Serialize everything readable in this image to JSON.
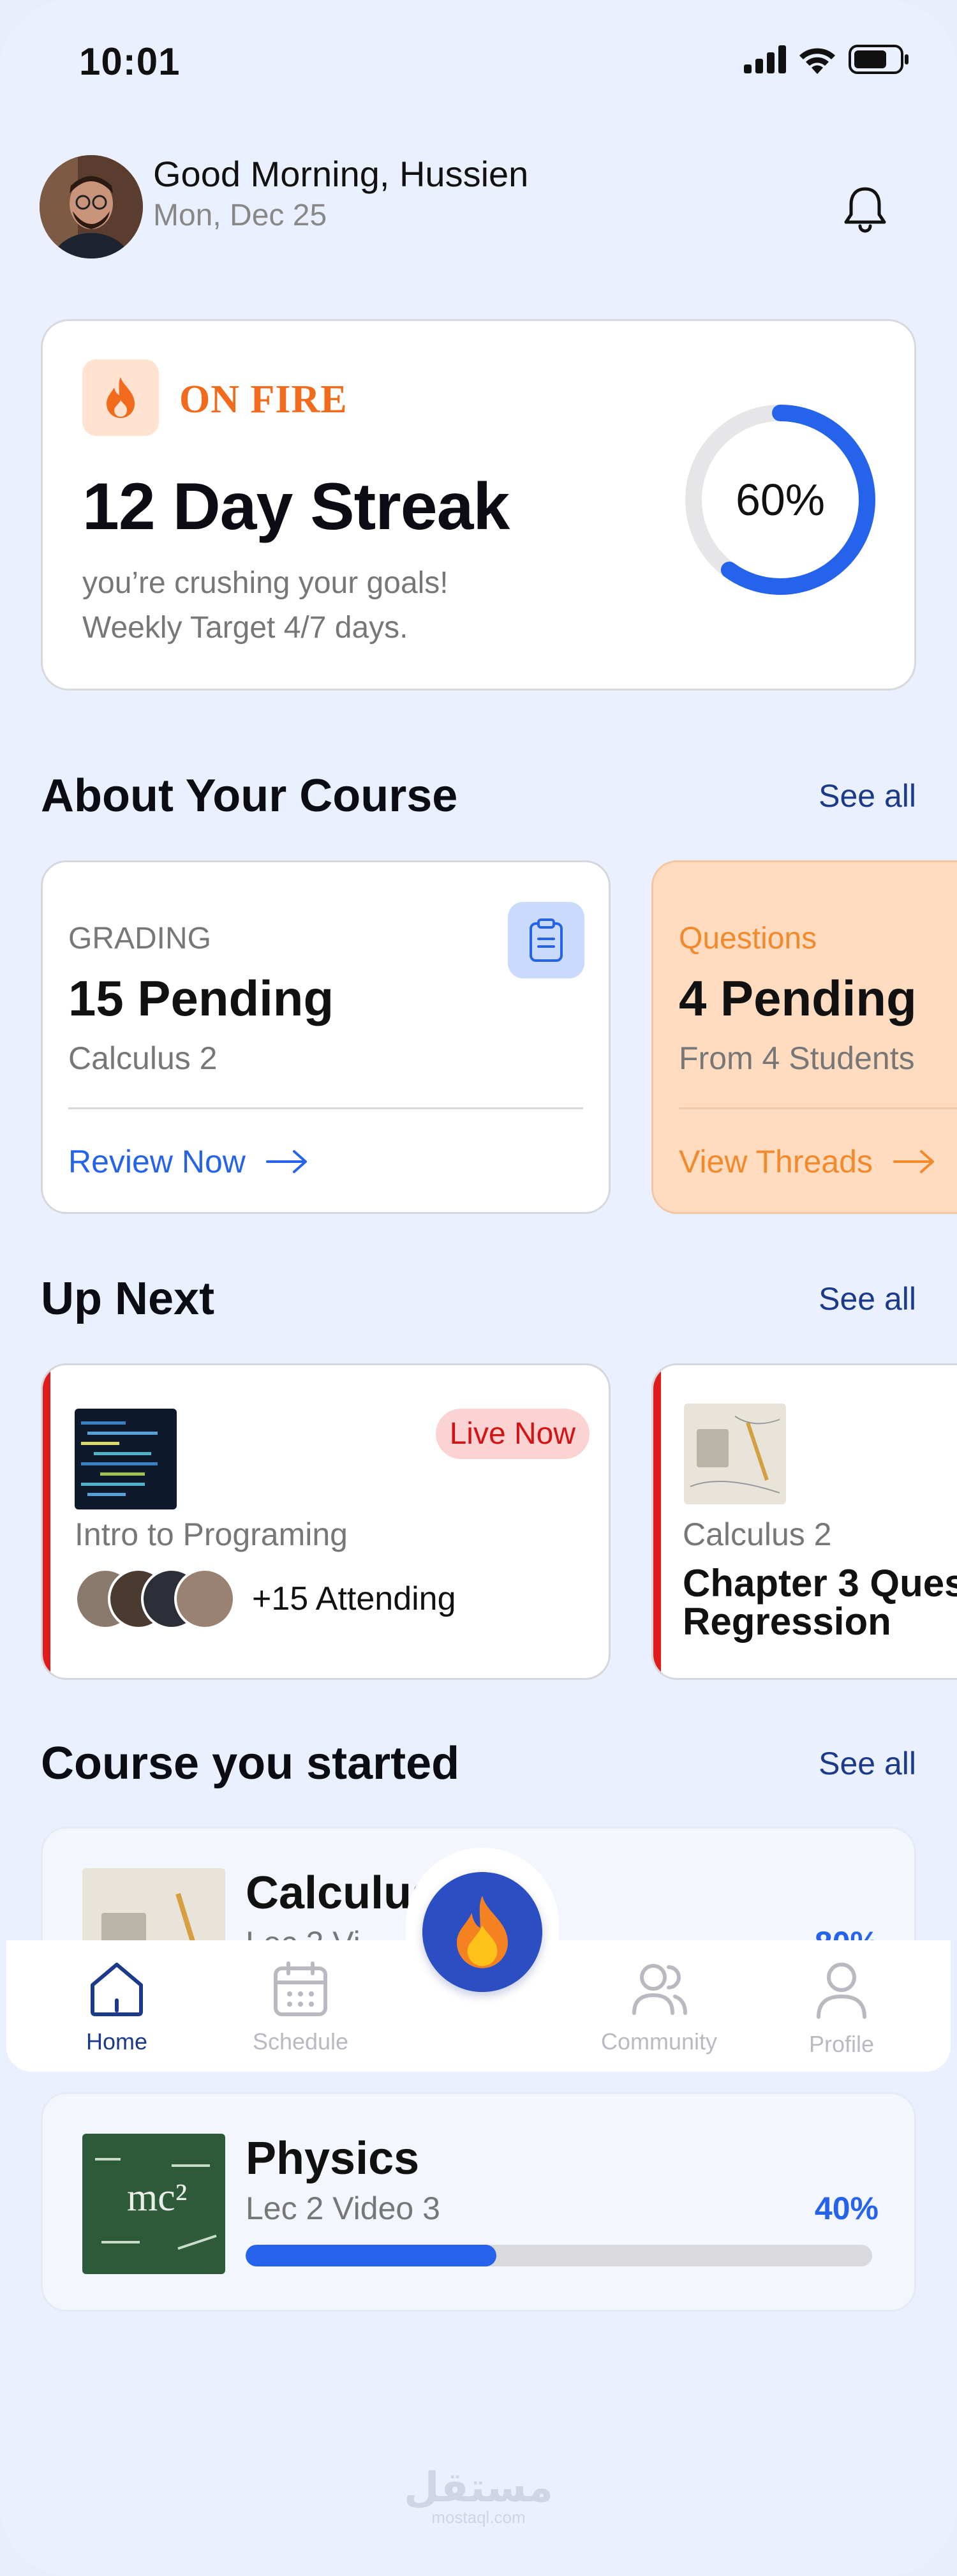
{
  "status_bar": {
    "time": "10:01"
  },
  "header": {
    "greeting": "Good Morning, Hussien",
    "date": "Mon, Dec 25"
  },
  "streak": {
    "badge": "ON FIRE",
    "title": "12 Day Streak",
    "subtitle": "you’re crushing your goals!",
    "target": "Weekly Target 4/7 days.",
    "progress_label": "60%",
    "progress": 0.6,
    "accent": "#2563eb",
    "fire_color": "#f26a1b"
  },
  "about_course": {
    "title": "About Your Course",
    "see_all": "See all",
    "cards": [
      {
        "label": "GRADING",
        "value": "15 Pending",
        "sub": "Calculus 2",
        "action": "Review Now"
      },
      {
        "label": "Questions",
        "value": "4 Pending",
        "sub": "From 4 Students",
        "action": "View Threads"
      }
    ]
  },
  "up_next": {
    "title": "Up Next",
    "see_all": "See all",
    "cards": [
      {
        "badge": "Live Now",
        "course": "Intro to Programing",
        "attending": "+15 Attending"
      },
      {
        "course": "Calculus 2",
        "title_line1": "Chapter 3 Ques",
        "title_line2": "Regression"
      }
    ]
  },
  "started": {
    "title": "Course you started",
    "see_all": "See all",
    "courses": [
      {
        "title": "Calculus",
        "lesson": "Lec 2 Vi",
        "percent": "80%",
        "progress": 0.8
      },
      {
        "title": "Physics",
        "lesson": "Lec 2 Video 3",
        "percent": "40%",
        "progress": 0.4
      }
    ]
  },
  "nav": {
    "home": "Home",
    "schedule": "Schedule",
    "community": "Community",
    "profile": "Profile"
  },
  "watermark": {
    "arabic": "مستقل",
    "latin": "mostaql.com"
  }
}
